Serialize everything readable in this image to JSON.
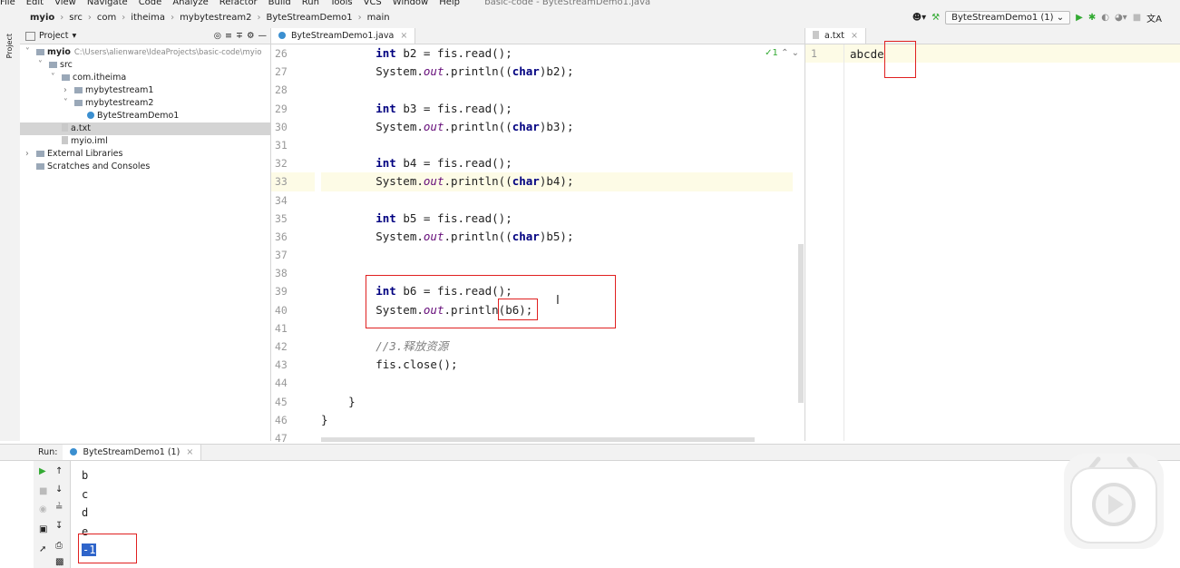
{
  "menu": [
    "File",
    "Edit",
    "View",
    "Navigate",
    "Code",
    "Analyze",
    "Refactor",
    "Build",
    "Run",
    "Tools",
    "VCS",
    "Window",
    "Help"
  ],
  "window_title": "basic-code - ByteStreamDemo1.java",
  "breadcrumb": [
    "myio",
    "src",
    "com",
    "itheima",
    "mybytestream2",
    "ByteStreamDemo1",
    "main"
  ],
  "run_config": "ByteStreamDemo1 (1)",
  "project_panel": {
    "title": "Project",
    "side_label": "Project",
    "tree": [
      {
        "label": "myio",
        "extra": "C:\\Users\\alienware\\IdeaProjects\\basic-code\\myio",
        "indent": 0,
        "type": "folder",
        "arrow": "v"
      },
      {
        "label": "src",
        "indent": 1,
        "type": "folder",
        "arrow": "v"
      },
      {
        "label": "com.itheima",
        "indent": 2,
        "type": "folder",
        "arrow": "v"
      },
      {
        "label": "mybytestream1",
        "indent": 3,
        "type": "folder",
        "arrow": ">"
      },
      {
        "label": "mybytestream2",
        "indent": 3,
        "type": "folder",
        "arrow": "v"
      },
      {
        "label": "ByteStreamDemo1",
        "indent": 4,
        "type": "class",
        "arrow": ""
      },
      {
        "label": "a.txt",
        "indent": 2,
        "type": "file",
        "arrow": "",
        "selected": true
      },
      {
        "label": "myio.iml",
        "indent": 2,
        "type": "file",
        "arrow": ""
      },
      {
        "label": "External Libraries",
        "indent": 0,
        "type": "lib",
        "arrow": ">"
      },
      {
        "label": "Scratches and Consoles",
        "indent": 0,
        "type": "lib",
        "arrow": ""
      }
    ]
  },
  "editor": {
    "tab": "ByteStreamDemo1.java",
    "inspection": "1",
    "line_numbers": [
      "26",
      "27",
      "28",
      "29",
      "30",
      "31",
      "32",
      "33",
      "34",
      "35",
      "36",
      "37",
      "38",
      "39",
      "40",
      "41",
      "42",
      "43",
      "44",
      "45",
      "46",
      "47"
    ],
    "code": [
      "        int b2 = fis.read();",
      "        System.out.println((char)b2);",
      "",
      "        int b3 = fis.read();",
      "        System.out.println((char)b3);",
      "",
      "        int b4 = fis.read();",
      "        System.out.println((char)b4);",
      "",
      "        int b5 = fis.read();",
      "        System.out.println((char)b5);",
      "",
      "",
      "        int b6 = fis.read();",
      "        System.out.println(b6);",
      "",
      "        //3.释放资源",
      "        fis.close();",
      "",
      "    }",
      "}",
      ""
    ]
  },
  "right_editor": {
    "tab": "a.txt",
    "line": "1",
    "content": "abcde"
  },
  "run_panel": {
    "label": "Run:",
    "tab": "ByteStreamDemo1 (1)",
    "output": [
      "b",
      "c",
      "d",
      "e",
      "-1"
    ]
  }
}
